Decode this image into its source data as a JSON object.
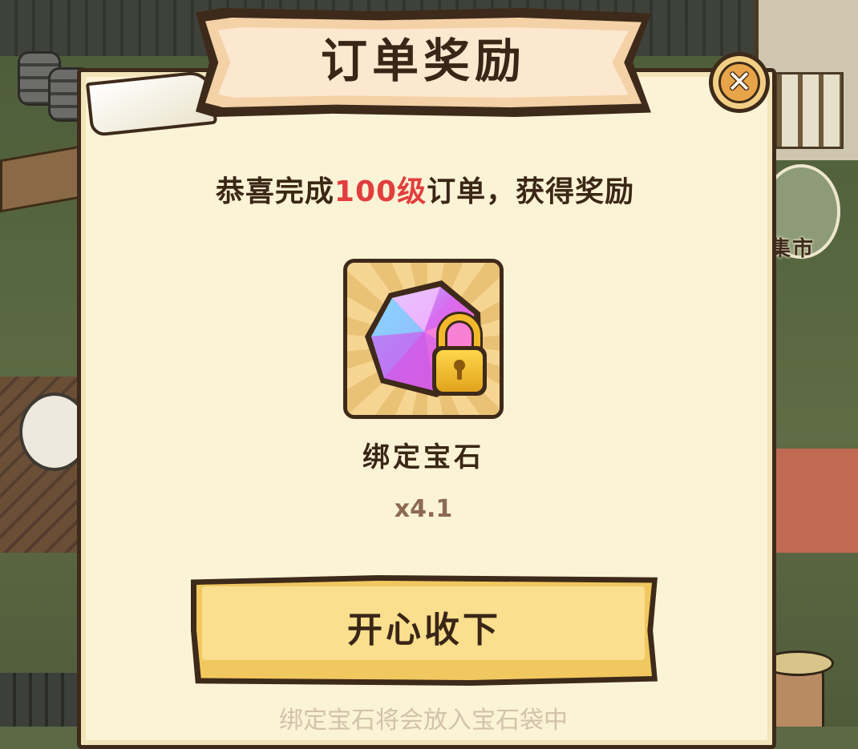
{
  "background": {
    "market_sign_label": "集市"
  },
  "dialog": {
    "title": "订单奖励",
    "close_glyph": "✕",
    "message": {
      "prefix": "恭喜完成",
      "highlight": "100级",
      "suffix": "订单，获得奖励",
      "highlight_color": "#e23e3e"
    },
    "reward": {
      "icon": "locked-gem-icon",
      "name": "绑定宝石",
      "quantity": "x4.1"
    },
    "confirm_label": "开心收下",
    "footnote": "绑定宝石将会放入宝石袋中"
  },
  "colors": {
    "panel": "#fbf3d6",
    "outline": "#3e2a1a",
    "button": "#f1c85f",
    "title_banner": "#fce7cf",
    "close_button": "#e8a449"
  }
}
